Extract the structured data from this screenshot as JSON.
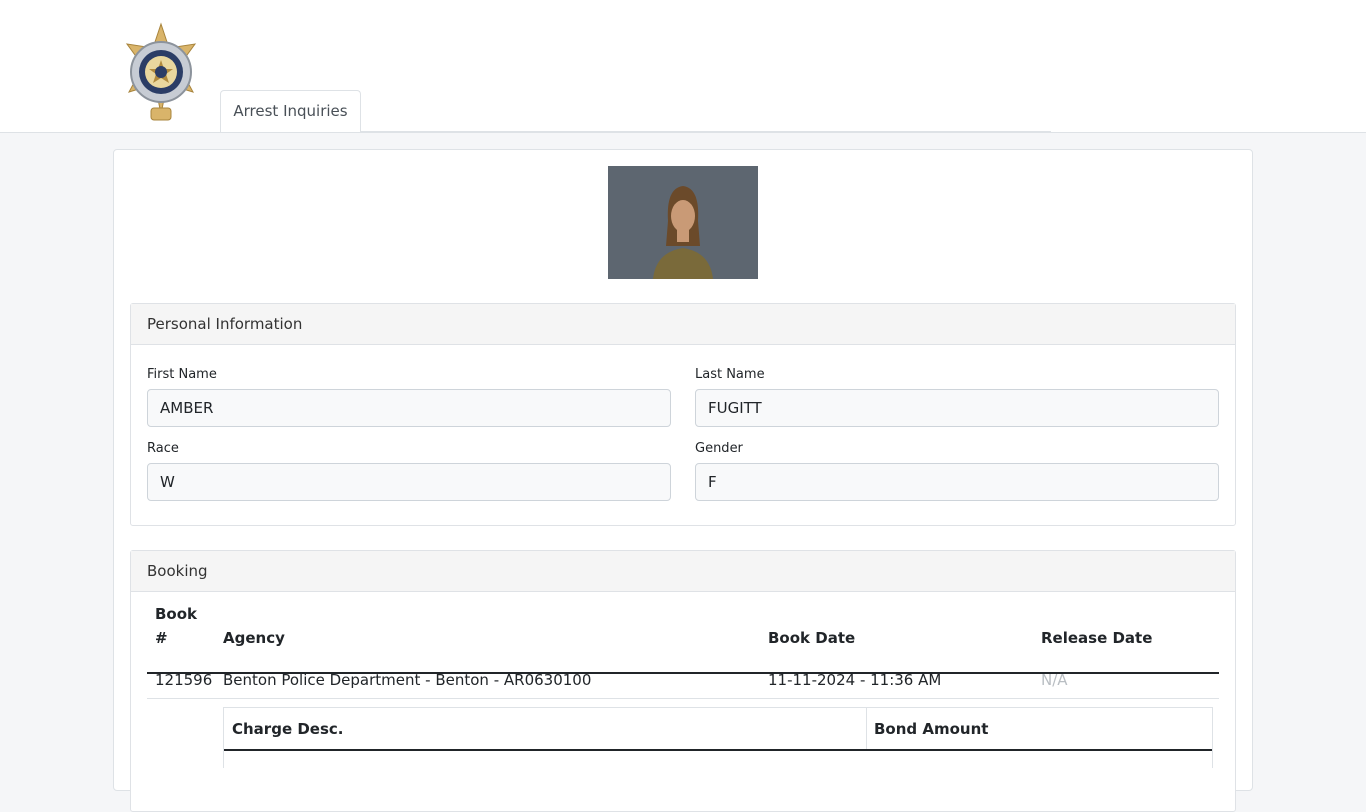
{
  "header": {
    "tab_label": "Arrest Inquiries"
  },
  "personal": {
    "title": "Personal Information",
    "first_name_label": "First Name",
    "first_name": "AMBER",
    "last_name_label": "Last Name",
    "last_name": "FUGITT",
    "race_label": "Race",
    "race": "W",
    "gender_label": "Gender",
    "gender": "F"
  },
  "booking": {
    "title": "Booking",
    "columns": {
      "book_line1": "Book",
      "book_line2": "#",
      "agency": "Agency",
      "book_date": "Book Date",
      "release_date": "Release Date"
    },
    "rows": [
      {
        "book_number": "121596",
        "agency": "Benton Police Department - Benton - AR0630100",
        "book_date": "11-11-2024 - 11:36 AM",
        "release_date": "N/A"
      }
    ],
    "charges": {
      "columns": {
        "desc": "Charge Desc.",
        "bond": "Bond Amount"
      }
    }
  },
  "colors": {
    "na_text": "#b9bec3",
    "photo_bg": "#5d6670"
  }
}
